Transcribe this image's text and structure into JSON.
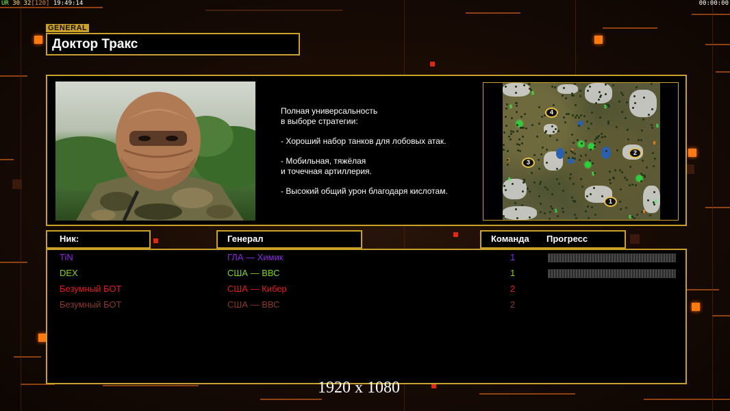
{
  "hud": {
    "fps_label": "UR",
    "fps": "30",
    "logic": "32",
    "logic_target": "[120]",
    "clock": "19:49:14",
    "timer": "00:00:00"
  },
  "general": {
    "tag": "GENERAL",
    "name": "Доктор Тракс"
  },
  "description": [
    "Полная универсальность\nв выборе стратегии:",
    "- Хороший набор танков для лобовых атак.",
    "- Мобильная, тяжёлая\nи точечная артиллерия.",
    "- Высокий общий урон благодаря кислотам."
  ],
  "minimap": {
    "start_positions": [
      "1",
      "2",
      "3",
      "4"
    ],
    "cash_symbol": "$"
  },
  "columns": {
    "nick": "Ник:",
    "general": "Генерал",
    "team": "Команда",
    "progress": "Прогресс"
  },
  "players": [
    {
      "nick": "TiN",
      "general": "ГЛА — Химик",
      "team": "1",
      "color": "#8a2be2",
      "has_progress": true
    },
    {
      "nick": "DEX",
      "general": "США — ВВС",
      "team": "1",
      "color": "#7fd71e",
      "has_progress": true
    },
    {
      "nick": "Безумный БОТ",
      "general": "США — Кибер",
      "team": "2",
      "color": "#e81a1a",
      "has_progress": false
    },
    {
      "nick": "Безумный БОТ",
      "general": "США — ВВС",
      "team": "2",
      "color": "#8a3a2a",
      "has_progress": false
    }
  ],
  "resolution": "1920 x 1080",
  "colors": {
    "frame": "#c9a227",
    "accent_orange": "#ff7a10"
  }
}
